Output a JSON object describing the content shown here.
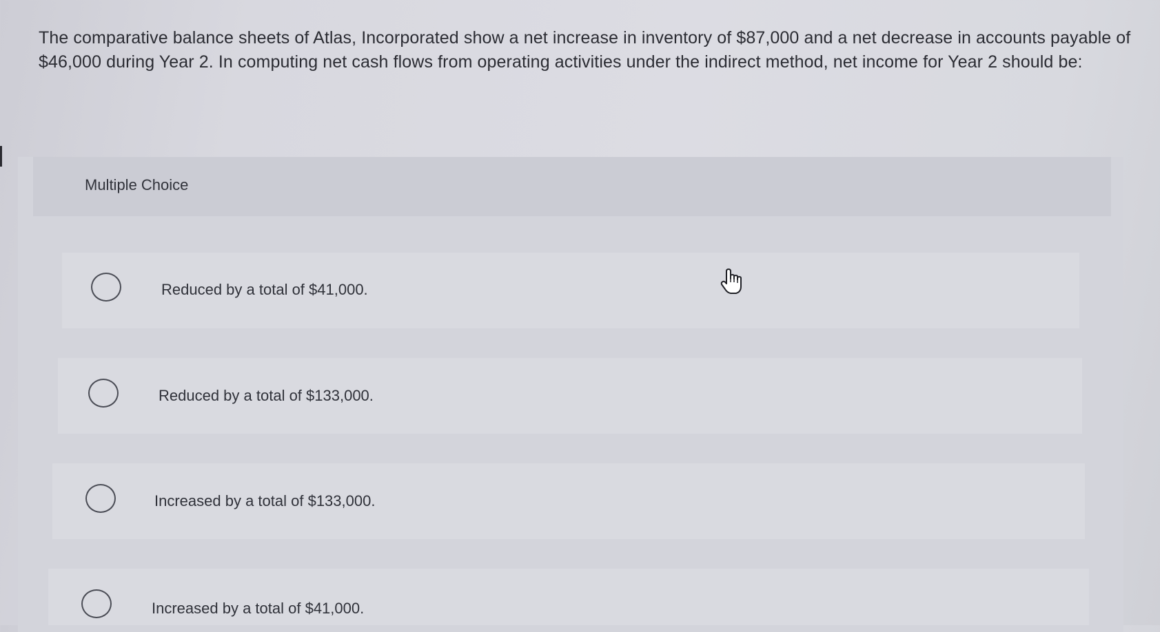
{
  "question": {
    "text": "The comparative balance sheets of Atlas, Incorporated show a net increase in inventory of $87,000 and a net decrease in accounts payable of $46,000 during Year 2. In computing net cash flows from operating activities under the indirect method, net income for Year 2 should be:"
  },
  "multiple_choice": {
    "label": "Multiple Choice",
    "options": [
      {
        "label": "Reduced by a total of $41,000."
      },
      {
        "label": "Reduced by a total of $133,000."
      },
      {
        "label": "Increased by a total of $133,000."
      },
      {
        "label": "Increased by a total of $41,000."
      }
    ]
  },
  "cursor": {
    "icon": "pointer-hand-icon"
  }
}
